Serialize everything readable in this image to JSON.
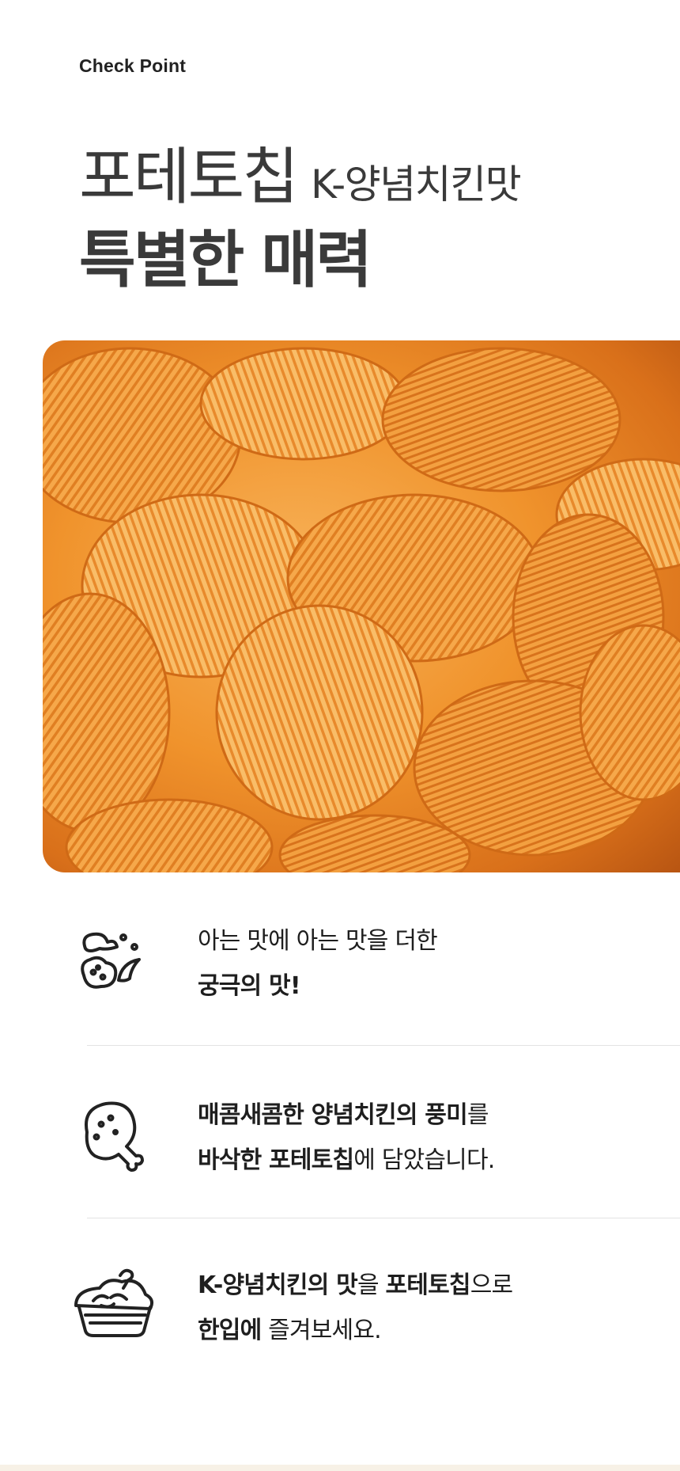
{
  "header": {
    "eyebrow": "Check Point",
    "title_main": "포테토칩",
    "title_sub": "K-양념치킨맛",
    "title_line2": "특별한 매력"
  },
  "photo": {
    "subject": "ridged orange potato chips",
    "accent": "#f0932c"
  },
  "points": [
    {
      "icon": "chicken-sauce-icon",
      "line1": "아는 맛에 아는 맛을 더한",
      "line2_bold": "궁극의 맛!"
    },
    {
      "icon": "drumstick-icon",
      "line1_bold": "매콤새콤한 양념치킨의 풍미",
      "line1_rest": "를",
      "line2_bold": "바삭한 포테토칩",
      "line2_rest": "에 담았습니다."
    },
    {
      "icon": "chip-basket-icon",
      "line1_bold_a": "K-양념치킨의 맛",
      "line1_mid": "을 ",
      "line1_bold_b": "포테토칩",
      "line1_rest": "으로",
      "line2_bold": "한입에",
      "line2_rest": " 즐겨보세요."
    }
  ],
  "colors": {
    "text": "#3a3a3a",
    "divider": "#e3e3e3",
    "footer": "#f7f1e6"
  }
}
